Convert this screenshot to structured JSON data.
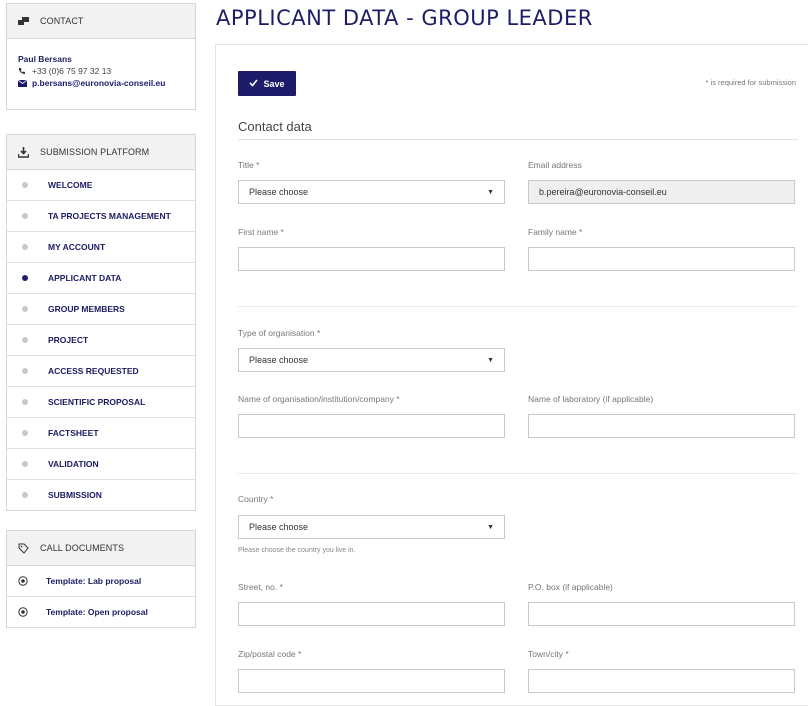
{
  "contact": {
    "header": "CONTACT",
    "name": "Paul Bersans",
    "phone": "+33 (0)6 75 97 32 13",
    "email": "p.bersans@euronovia-conseil.eu"
  },
  "submission": {
    "header": "SUBMISSION PLATFORM",
    "items": [
      {
        "label": "WELCOME",
        "active": false
      },
      {
        "label": "TA PROJECTS MANAGEMENT",
        "active": false
      },
      {
        "label": "MY ACCOUNT",
        "active": false
      },
      {
        "label": "APPLICANT DATA",
        "active": true
      },
      {
        "label": "GROUP MEMBERS",
        "active": false
      },
      {
        "label": "PROJECT",
        "active": false
      },
      {
        "label": "ACCESS REQUESTED",
        "active": false
      },
      {
        "label": "SCIENTIFIC PROPOSAL",
        "active": false
      },
      {
        "label": "FACTSHEET",
        "active": false
      },
      {
        "label": "VALIDATION",
        "active": false
      },
      {
        "label": "SUBMISSION",
        "active": false
      }
    ]
  },
  "call_documents": {
    "header": "CALL DOCUMENTS",
    "items": [
      "Template: Lab proposal",
      "Template: Open proposal"
    ]
  },
  "page": {
    "title": "APPLICANT DATA - GROUP LEADER",
    "save_label": "Save",
    "required_note": "* is required for submission",
    "section_title": "Contact data"
  },
  "form": {
    "title_label": "Title *",
    "title_value": "Please choose",
    "email_label": "Email address",
    "email_value": "b.pereira@euronovia-conseil.eu",
    "first_name_label": "First name *",
    "family_name_label": "Family name *",
    "org_type_label": "Type of organisation *",
    "org_type_value": "Please choose",
    "org_name_label": "Name of organisation/institution/company *",
    "lab_name_label": "Name of laboratory (if applicable)",
    "country_label": "Country *",
    "country_value": "Please choose",
    "country_hint": "Please choose the country you live in.",
    "street_label": "Street, no. *",
    "po_box_label": "P.O. box (if applicable)",
    "zip_label": "Zip/postal code *",
    "town_label": "Town/city *"
  },
  "colors": {
    "accent": "#1c1c6b",
    "active_dot": "#1e1e6b",
    "inactive_dot": "#c8c8c8"
  }
}
